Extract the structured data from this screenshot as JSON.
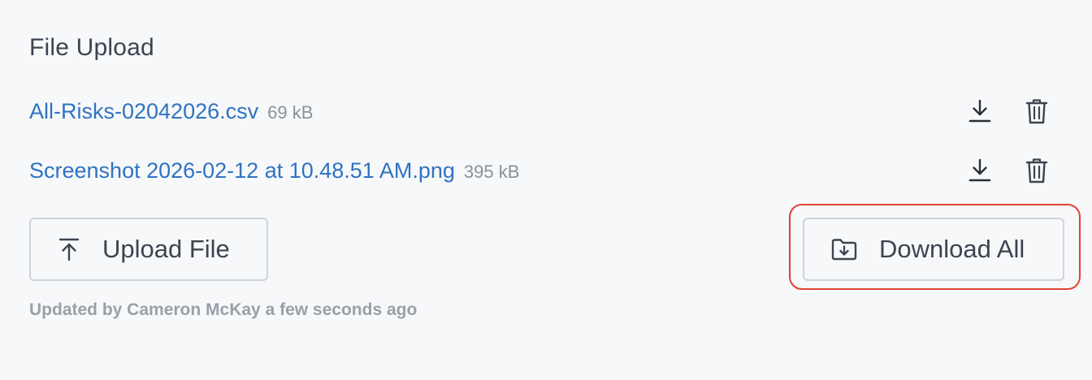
{
  "section": {
    "title": "File Upload"
  },
  "files": [
    {
      "name": "All-Risks-02042026.csv",
      "size": "69 kB",
      "download_icon": "download-icon",
      "delete_icon": "trash-icon"
    },
    {
      "name": "Screenshot 2026-02-12 at 10.48.51 AM.png",
      "size": "395 kB",
      "download_icon": "download-icon",
      "delete_icon": "trash-icon"
    }
  ],
  "actions": {
    "upload_label": "Upload File",
    "upload_icon": "upload-arrow-icon",
    "download_all_label": "Download All",
    "download_all_icon": "folder-download-icon"
  },
  "footer": {
    "updated_text": "Updated by Cameron McKay a few seconds ago"
  },
  "colors": {
    "link": "#2f73c0",
    "highlight": "#e0442f",
    "text": "#3d4450",
    "muted": "#8a9099"
  }
}
